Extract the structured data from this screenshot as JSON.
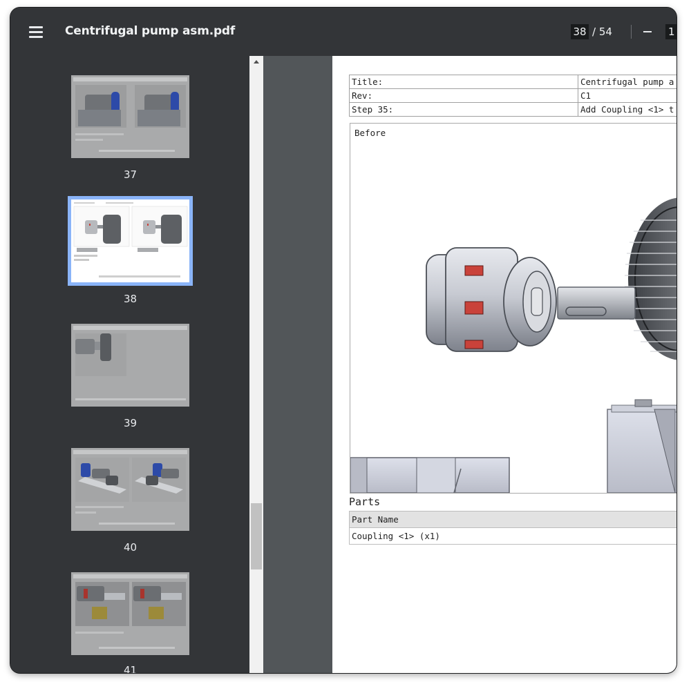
{
  "toolbar": {
    "title": "Centrifugal pump asm.pdf",
    "current_page": "38",
    "total_pages": "/ 54",
    "zoom_value": "1"
  },
  "thumbnails": [
    {
      "label": "37"
    },
    {
      "label": "38"
    },
    {
      "label": "39"
    },
    {
      "label": "40"
    },
    {
      "label": "41"
    }
  ],
  "page": {
    "meta_rows": [
      {
        "key": "Title:",
        "value": "Centrifugal pump a"
      },
      {
        "key": "Rev:",
        "value": "C1"
      },
      {
        "key": "Step 35:",
        "value": "Add Coupling <1> t"
      }
    ],
    "before_label": "Before",
    "parts_heading": "Parts",
    "parts_column": "Part Name",
    "parts_rows": [
      "Coupling <1> (x1)"
    ]
  },
  "colors": {
    "accent": "#8ab4f8",
    "toolbar_bg": "#333538",
    "viewer_bg": "#525659",
    "coupling_insert": "#c9423a"
  }
}
